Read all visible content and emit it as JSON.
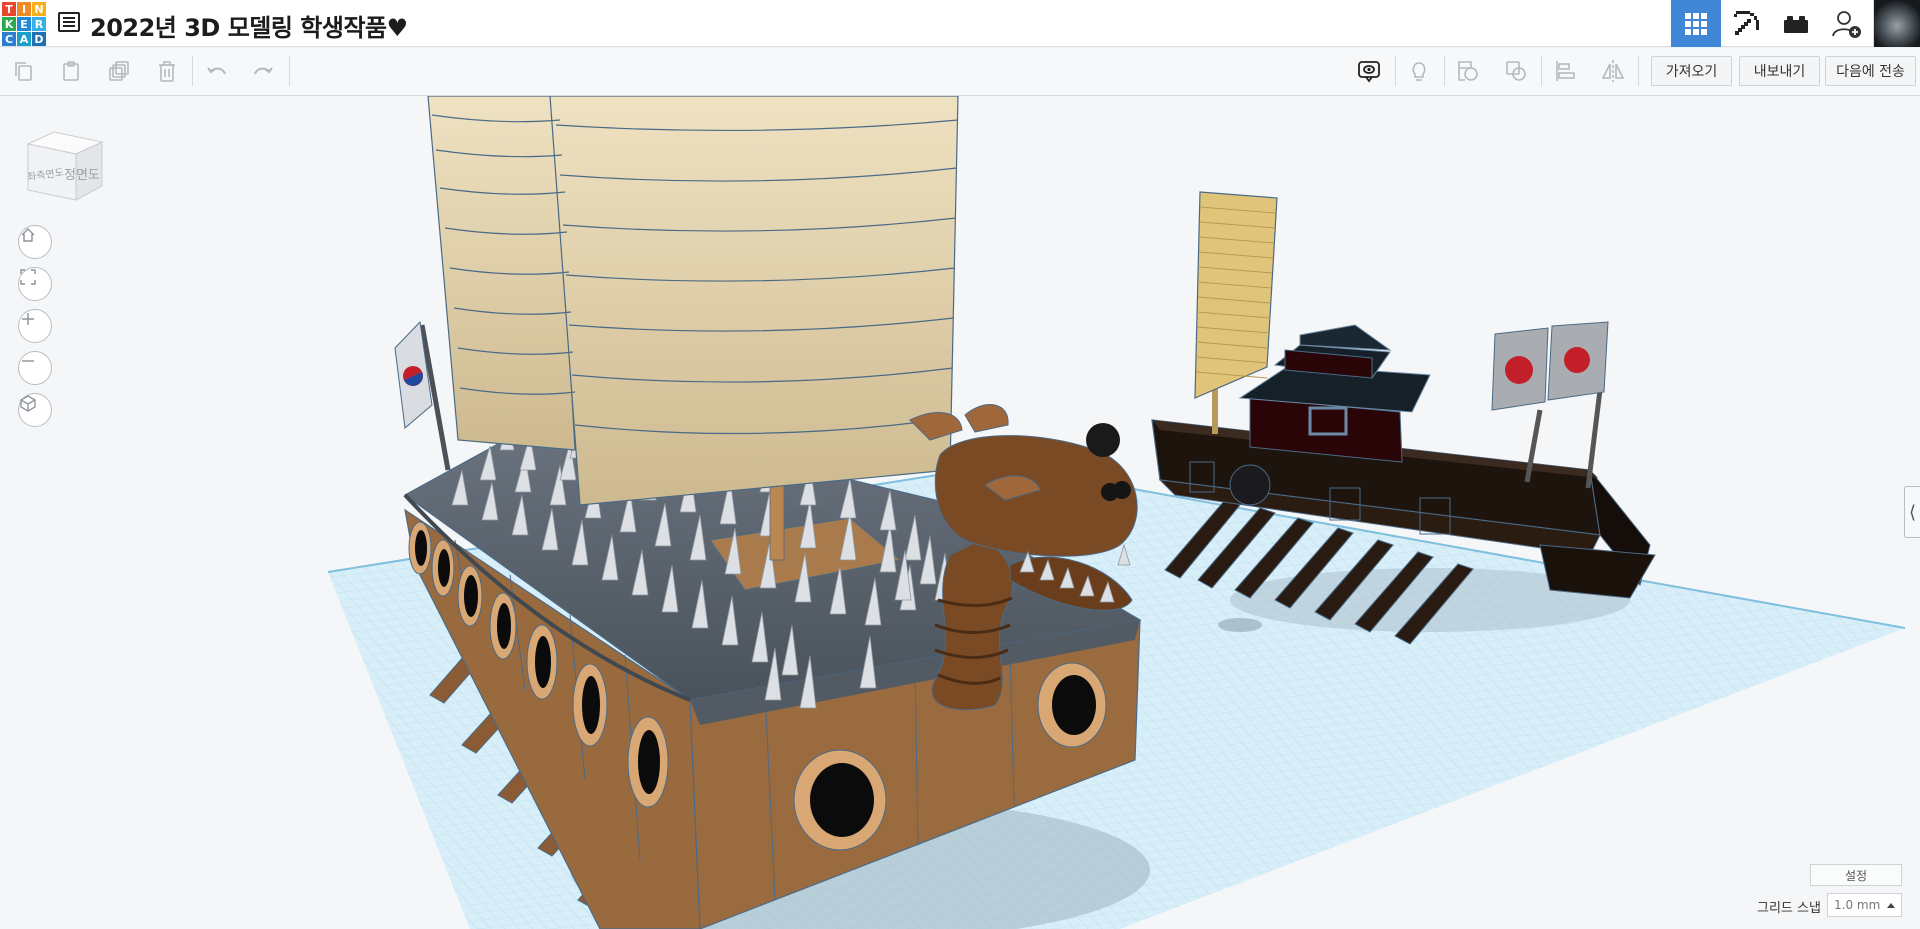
{
  "logo": {
    "letters": [
      "T",
      "I",
      "N",
      "K",
      "E",
      "R",
      "C",
      "A",
      "D"
    ]
  },
  "design": {
    "title": "2022년 3D 모델링 학생작품♥"
  },
  "header": {
    "views": [
      "grid-view-icon",
      "pickaxe-icon",
      "brick-icon",
      "add-user-icon"
    ],
    "accent_color": "#3f86d6"
  },
  "toolbar": {
    "tools": [
      "copy-icon",
      "paste-icon",
      "duplicate-icon",
      "delete-icon",
      "undo-icon",
      "redo-icon"
    ],
    "right_tools": [
      "notes-icon",
      "light-bulb-icon",
      "solid-shape-icon",
      "group-icon",
      "align-icon",
      "mirror-icon"
    ],
    "import_label": "가져오기",
    "export_label": "내보내기",
    "send_label": "다음에 전송"
  },
  "viewcube": {
    "left_face": "좌측면도",
    "front_face": "정면도"
  },
  "navigation": [
    "home-icon",
    "fit-view-icon",
    "zoom-in-icon",
    "zoom-out-icon",
    "ortho-view-icon"
  ],
  "scene": {
    "grid_color": "#cde9f6",
    "left_ship_colors": {
      "hull": "#9a6a3f",
      "roof": "#5e6670",
      "sail": "#e6d6b0",
      "dragon": "#7a4a25"
    },
    "right_ship_colors": {
      "hull": "#231711",
      "sail": "#e0c47a",
      "flag": "#c21f2b"
    }
  },
  "footer": {
    "settings_label": "설정",
    "grid_snap_label": "그리드 스냅",
    "grid_snap_value": "1.0 mm"
  }
}
